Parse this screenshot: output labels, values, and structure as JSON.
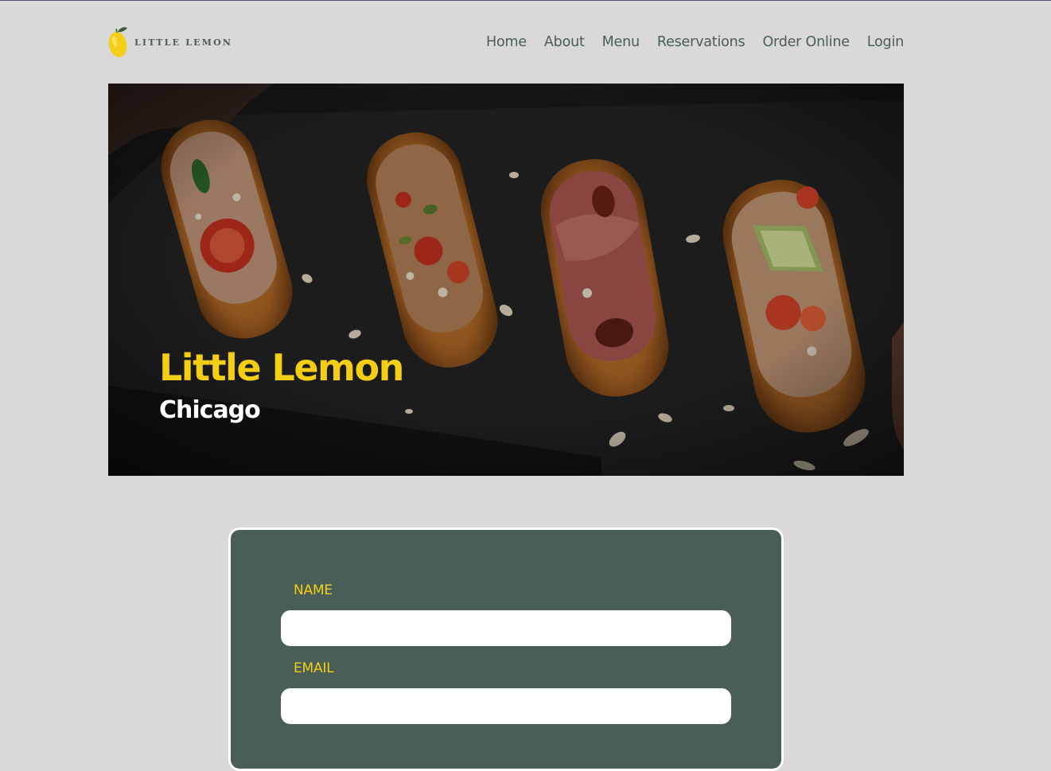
{
  "brand": {
    "logo_text": "LITTLE LEMON",
    "logo_icon": "lemon-icon",
    "primary_color": "#495e57",
    "accent_color": "#f4ce14"
  },
  "nav": {
    "items": [
      {
        "label": "Home"
      },
      {
        "label": "About"
      },
      {
        "label": "Menu"
      },
      {
        "label": "Reservations"
      },
      {
        "label": "Order Online"
      },
      {
        "label": "Login"
      }
    ]
  },
  "hero": {
    "title": "Little Lemon",
    "subtitle": "Chicago"
  },
  "form": {
    "fields": [
      {
        "label": "NAME",
        "value": ""
      },
      {
        "label": "EMAIL",
        "value": ""
      }
    ]
  }
}
